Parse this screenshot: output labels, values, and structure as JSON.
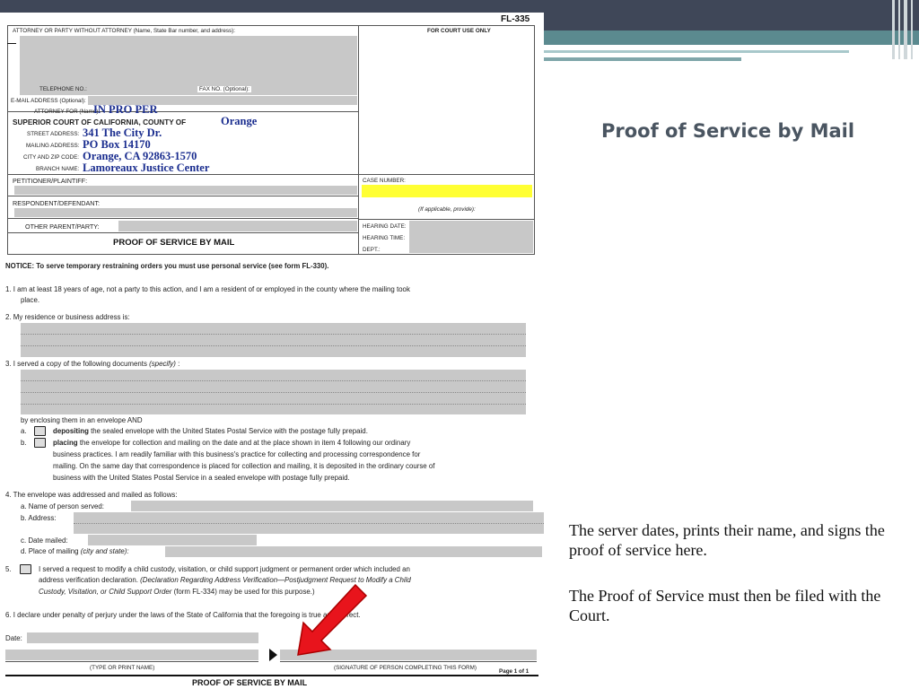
{
  "slide": {
    "title": "Proof of Service by Mail",
    "note1": "The server dates, prints their name, and signs the proof of service here.",
    "note2": "The Proof of Service must then be filed with the Court."
  },
  "form": {
    "form_number": "FL-335",
    "attorney_label": "ATTORNEY OR PARTY WITHOUT ATTORNEY (Name, State Bar number, and address):",
    "court_use": "FOR COURT USE ONLY",
    "telephone": "TELEPHONE NO.:",
    "fax": "FAX NO. (Optional):",
    "email": "E-MAIL ADDRESS (Optional):",
    "attorney_for": "ATTORNEY FOR (Name):",
    "attorney_for_value": "IN PRO PER",
    "court_label": "SUPERIOR COURT OF CALIFORNIA, COUNTY OF",
    "county_value": "Orange",
    "street_label": "STREET ADDRESS:",
    "street_value": "341 The City Dr.",
    "mailing_label": "MAILING ADDRESS:",
    "mailing_value": "PO Box 14170",
    "city_label": "CITY AND ZIP CODE:",
    "city_value": "Orange, CA  92863-1570",
    "branch_label": "BRANCH NAME:",
    "branch_value": "Lamoreaux Justice Center",
    "petitioner": "PETITIONER/PLAINTIFF:",
    "respondent": "RESPONDENT/DEFENDANT:",
    "other_parent": "OTHER PARENT/PARTY:",
    "case_number": "CASE NUMBER:",
    "if_applicable": "(If applicable, provide):",
    "hearing_date": "HEARING DATE:",
    "hearing_time": "HEARING TIME:",
    "dept": "DEPT.:",
    "form_title": "PROOF OF SERVICE BY MAIL",
    "notice": "NOTICE: To serve temporary restraining orders you must use personal service (see form FL-330).",
    "item1_a": "1.   I am at least 18 years of age, not a party to this action, and I am a resident of or employed in the county where the mailing took",
    "item1_b": "place.",
    "item2": "2.   My residence or business address is:",
    "item3": "3.   I served a copy of the following documents",
    "item3_specify": "(specify)",
    "item3_colon": ":",
    "enclosing": "by enclosing them in an envelope AND",
    "a_label": "a.",
    "a_bold": "depositing",
    "a_text": " the sealed envelope with the United States Postal Service with the postage fully prepaid.",
    "b_label": "b.",
    "b_bold": "placing",
    "b_text1": " the envelope for collection and mailing on the date and at the place shown in item 4 following our ordinary",
    "b_text2": "business practices. I am readily familiar with this business's practice for collecting and processing correspondence for",
    "b_text3": "mailing. On the same day that correspondence is placed for collection and mailing, it is deposited in the ordinary course of",
    "b_text4": "business with the United States Postal Service in a sealed envelope with postage fully prepaid.",
    "item4": "4.   The envelope was addressed and mailed as follows:",
    "item4a": "a.   Name of person served:",
    "item4b": "b.   Address:",
    "item4c": "c.   Date mailed:",
    "item4d": "d.   Place of mailing",
    "item4d_italic": "(city and state):",
    "item5_num": "5.",
    "item5_a": "I served a request to modify a child custody, visitation, or child support judgment or permanent order which included an",
    "item5_b1": "address verification declaration.",
    "item5_b2": "(Declaration Regarding Address Verification—Postjudgment Request to Modify a Child",
    "item5_c1": "Custody, Visitation, or Child Support Order",
    "item5_c2": "(form FL-334) may be used for this purpose.)",
    "item6": "6.   I declare under penalty of perjury under the laws of the State of California that the foregoing is true and correct.",
    "date_label": "Date:",
    "type_name": "(TYPE OR PRINT NAME)",
    "signature": "(SIGNATURE OF PERSON COMPLETING THIS FORM)",
    "page": "Page 1 of 1",
    "footer_title": "PROOF OF SERVICE BY MAIL"
  },
  "colors": {
    "header_band": "#3f4758",
    "teal": "#5b8a8f",
    "field_gray": "#c8c8c8",
    "highlight": "#ffff33",
    "handwriting": "#1a2d8f",
    "arrow": "#e8141c"
  }
}
